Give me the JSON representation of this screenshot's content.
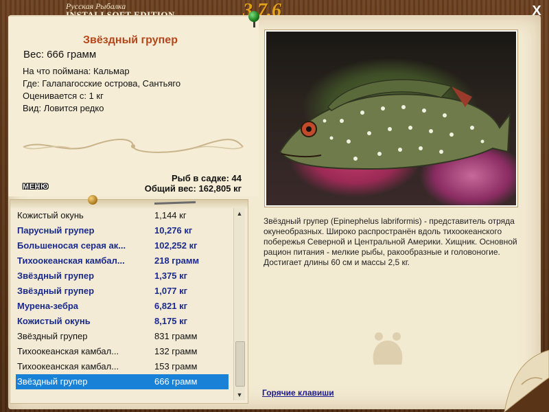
{
  "header": {
    "title_top": "Русская Рыбалка",
    "title_main": "INSTALLSOFT EDITION",
    "version": "3.7.6",
    "close_label": "X"
  },
  "fish": {
    "name": "Звёздный групер",
    "weight": "Вес: 666 грамм",
    "caught_with": "На что поймана: Кальмар",
    "where": "Где: Галапагосские острова, Сантьяго",
    "rated_from": "Оценивается с: 1 кг",
    "kind": "Вид: Ловится редко"
  },
  "cage": {
    "count": "Рыб в садке: 44",
    "total": "Общий вес: 162,805 кг"
  },
  "menu_label": "МЕНЮ",
  "description": "Звёздный групер (Epinephelus labriformis) - представитель отряда окунеобразных. Широко распространён вдоль тихоокеанского побережья Северной и Центральной Америки. Хищник. Основной рацион питания - мелкие рыбы, ракообразные и головоногие. Достигает длины 60 см и массы 2,5 кг.",
  "hotkeys_label": "Горячие клавиши",
  "list": [
    {
      "name": "Кожистый окунь",
      "weight": "1,144 кг",
      "bold": false,
      "selected": false
    },
    {
      "name": "Парусный групер",
      "weight": "10,276 кг",
      "bold": true,
      "selected": false
    },
    {
      "name": "Большеносая серая ак...",
      "weight": "102,252 кг",
      "bold": true,
      "selected": false
    },
    {
      "name": "Тихоокеанская камбал...",
      "weight": "218 грамм",
      "bold": true,
      "selected": false
    },
    {
      "name": "Звёздный групер",
      "weight": "1,375 кг",
      "bold": true,
      "selected": false
    },
    {
      "name": "Звёздный групер",
      "weight": "1,077 кг",
      "bold": true,
      "selected": false
    },
    {
      "name": "Мурена-зебра",
      "weight": "6,821 кг",
      "bold": true,
      "selected": false
    },
    {
      "name": "Кожистый окунь",
      "weight": "8,175 кг",
      "bold": true,
      "selected": false
    },
    {
      "name": "Звёздный групер",
      "weight": "831 грамм",
      "bold": false,
      "selected": false
    },
    {
      "name": "Тихоокеанская камбал...",
      "weight": "132 грамм",
      "bold": false,
      "selected": false
    },
    {
      "name": "Тихоокеанская камбал...",
      "weight": "153 грамм",
      "bold": false,
      "selected": false
    },
    {
      "name": "Звёздный групер",
      "weight": "666 грамм",
      "bold": false,
      "selected": true
    }
  ],
  "colors": {
    "accent_name": "#b4461a",
    "list_bold": "#1a2a8c",
    "selection": "#1a82d6",
    "version": "#e2a21a"
  }
}
